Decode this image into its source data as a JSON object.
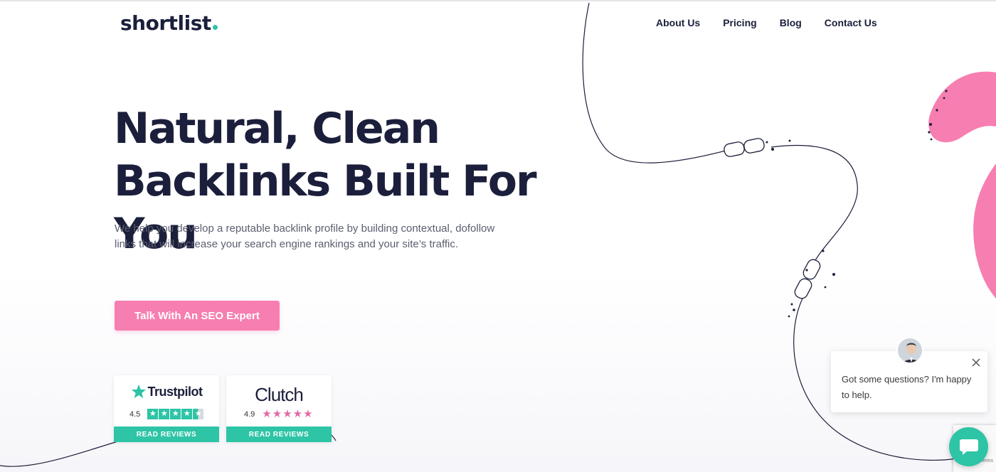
{
  "header": {
    "logo": "shortlist",
    "nav": [
      "About Us",
      "Pricing",
      "Blog",
      "Contact Us"
    ]
  },
  "hero": {
    "headline_line1": "Natural, Clean",
    "headline_line2": "Backlinks Built For You",
    "subtext": "We help you develop a reputable backlink profile by building contextual, dofollow links that will increase your search engine rankings and your site’s traffic.",
    "cta": "Talk With An SEO Expert"
  },
  "badges": {
    "trustpilot": {
      "name": "Trustpilot",
      "score": "4.5",
      "rating": 4.5,
      "reviews_label": "READ REVIEWS"
    },
    "clutch": {
      "name": "Clutch",
      "score": "4.9",
      "rating": 4.9,
      "reviews_label": "READ REVIEWS"
    }
  },
  "chat": {
    "message": "Got some questions? I'm happy to help."
  },
  "recaptcha": {
    "terms": "Terms"
  },
  "colors": {
    "navy": "#1b1f3b",
    "pink": "#f77eb0",
    "teal": "#2ec4a6",
    "clutch_star": "#e36aa6"
  },
  "icons": {
    "trustpilot": "trustpilot-star-icon",
    "chat_close": "close-icon",
    "chat_launcher": "chat-bubble-icon"
  }
}
